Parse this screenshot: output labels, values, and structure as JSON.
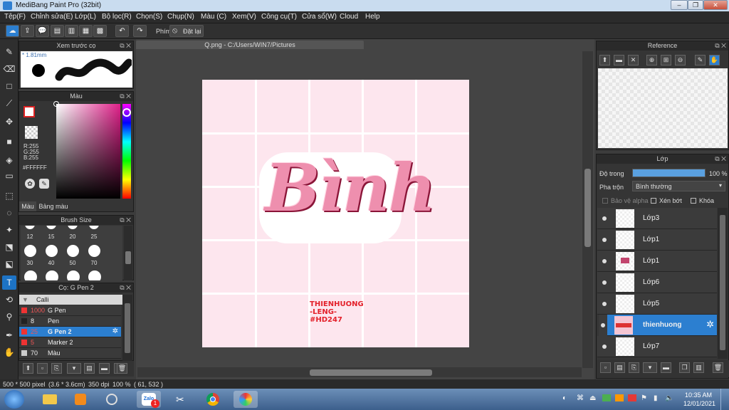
{
  "title": "MediBang Paint Pro (32bit)",
  "menu": [
    "Tệp(F)",
    "Chỉnh sửa(E)",
    "Lớp(L)",
    "Bộ lọc(R)",
    "Chọn(S)",
    "Chụp(N)",
    "Màu (C)",
    "Xem(V)",
    "Công cụ(T)",
    "Cửa sổ(W)",
    "Cloud",
    "Help"
  ],
  "toolbar": {
    "shortcut_label": "Phím",
    "reset_label": "Đặt lại"
  },
  "preview": {
    "title": "Xem trước cọ",
    "size": "1.81mm"
  },
  "color": {
    "title": "Màu",
    "r": "R:255",
    "g": "G:255",
    "b": "B:255",
    "hex": "#FFFFFF",
    "tab1": "Màu",
    "tab2": "Bảng màu"
  },
  "brush_size": {
    "title": "Brush Size",
    "row1": [
      "12",
      "15",
      "20",
      "25"
    ],
    "row2": [
      "30",
      "40",
      "50",
      "70"
    ]
  },
  "brush": {
    "title": "Cọ: G Pen 2",
    "group": "Calli",
    "items": [
      {
        "size": "1000",
        "name": "G Pen"
      },
      {
        "size": "8",
        "name": "Pen"
      },
      {
        "size": "25",
        "name": "G Pen 2"
      },
      {
        "size": "5",
        "name": "Marker 2"
      },
      {
        "size": "70",
        "name": "Màu"
      }
    ]
  },
  "document": {
    "tab": "Q.png - C:/Users/WIN7/Pictures",
    "art_title": "Bình",
    "sig_line1": "THIENHUONG",
    "sig_line2": "-LENG-",
    "sig_line3": "#HD247"
  },
  "reference": {
    "title": "Reference"
  },
  "layers": {
    "title": "Lớp",
    "opacity_label": "Độ trong",
    "opacity_value": "100 %",
    "opacity": 1.0,
    "blend_label": "Pha trộn",
    "blend_value": "Bình thường",
    "protect_alpha": "Bảo vệ alpha",
    "clipping": "Xén bớt",
    "lock": "Khóa",
    "items": [
      "Lớp3",
      "Lớp1",
      "Lớp1",
      "Lớp6",
      "Lớp5",
      "thienhuong",
      "Lớp7"
    ]
  },
  "status": {
    "size": "500 * 500 pixel",
    "cm": "(3.6 * 3.6cm)",
    "dpi": "350 dpi",
    "zoom": "100 %",
    "coords": "( 61, 532 )"
  },
  "taskbar": {
    "time": "10:35 AM",
    "date": "12/01/2021",
    "zalo": "Zalo",
    "badge": "1"
  }
}
